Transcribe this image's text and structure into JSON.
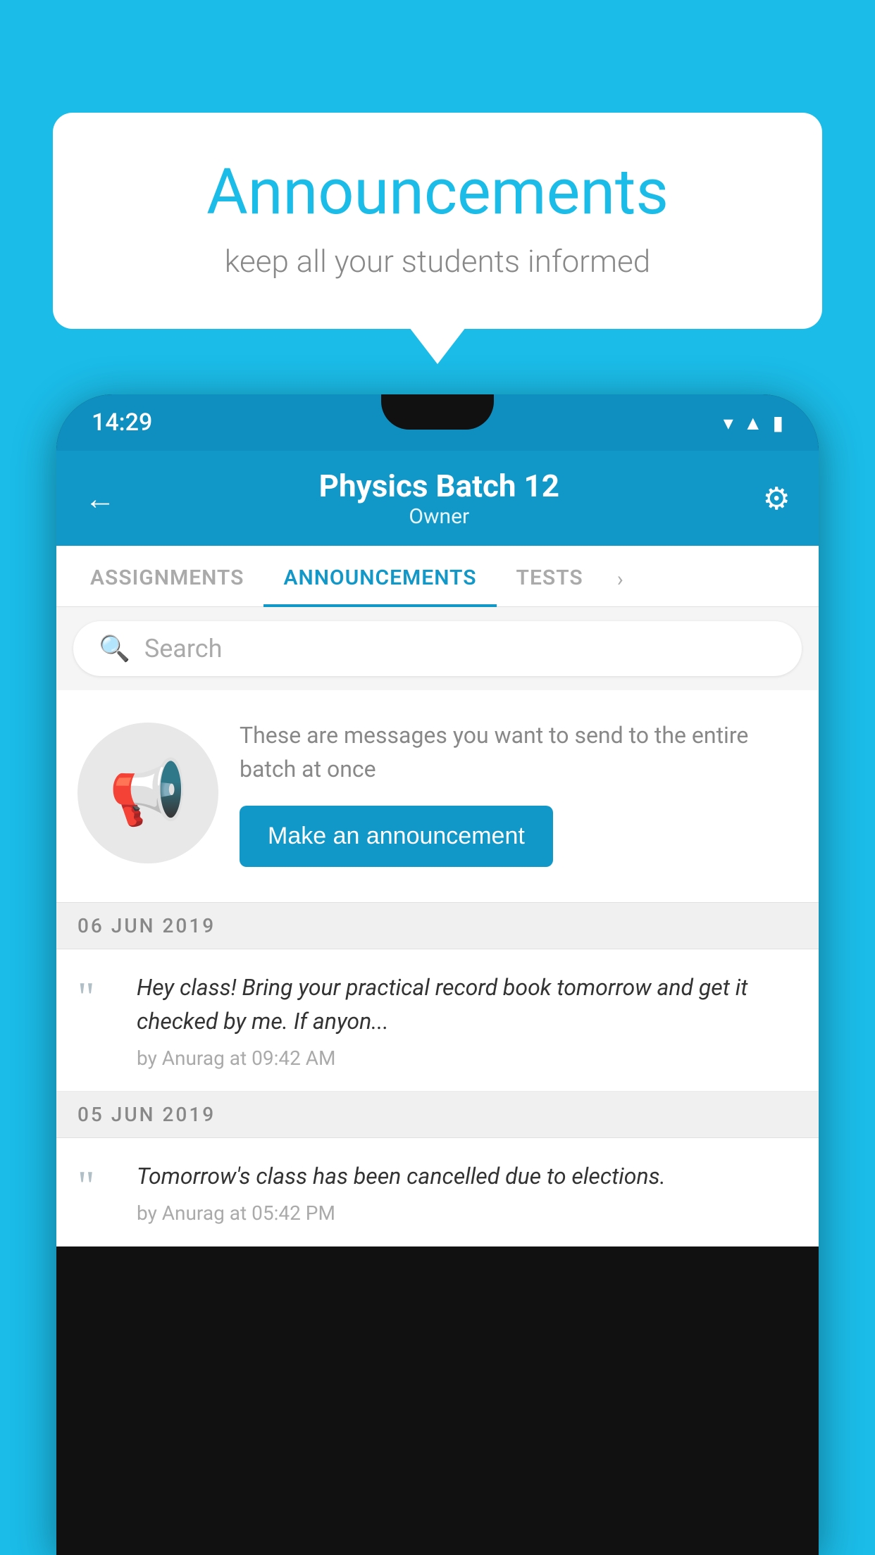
{
  "background_color": "#1BBCE8",
  "speech_bubble": {
    "title": "Announcements",
    "subtitle": "keep all your students informed"
  },
  "phone": {
    "status_bar": {
      "time": "14:29",
      "wifi_icon": "▾",
      "signal_icon": "▲",
      "battery_icon": "▮"
    },
    "header": {
      "back_label": "←",
      "title": "Physics Batch 12",
      "subtitle": "Owner",
      "settings_icon": "⚙"
    },
    "tabs": [
      {
        "label": "ASSIGNMENTS",
        "active": false
      },
      {
        "label": "ANNOUNCEMENTS",
        "active": true
      },
      {
        "label": "TESTS",
        "active": false
      }
    ],
    "search": {
      "placeholder": "Search"
    },
    "promo": {
      "description": "These are messages you want to send to the entire batch at once",
      "button_label": "Make an announcement"
    },
    "announcements": [
      {
        "date": "06  JUN  2019",
        "text": "Hey class! Bring your practical record book tomorrow and get it checked by me. If anyon...",
        "meta": "by Anurag at 09:42 AM"
      },
      {
        "date": "05  JUN  2019",
        "text": "Tomorrow's class has been cancelled due to elections.",
        "meta": "by Anurag at 05:42 PM"
      }
    ]
  }
}
